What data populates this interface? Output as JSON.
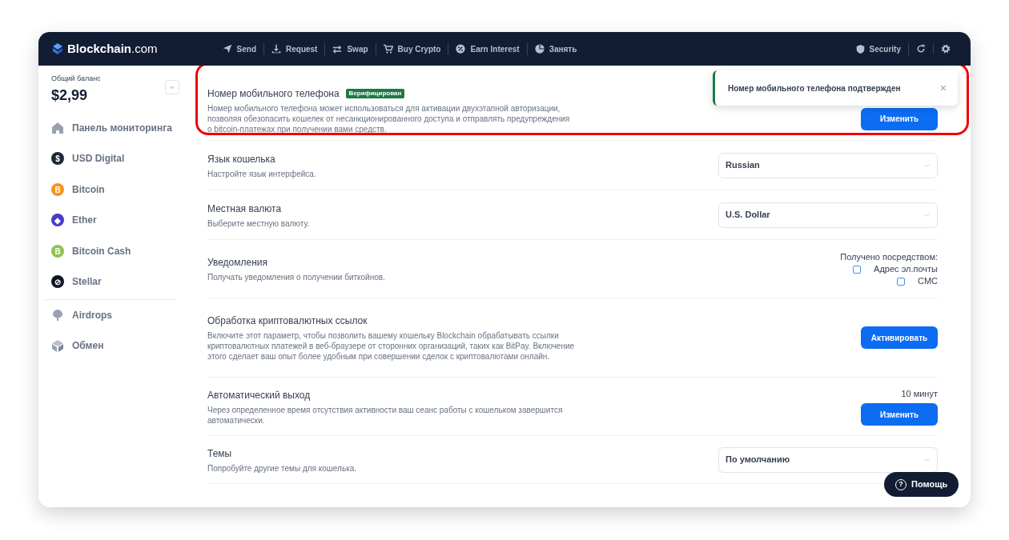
{
  "navbar": {
    "logo": {
      "name": "Blockchain",
      "suffix": ".com"
    },
    "items": [
      {
        "label": "Send",
        "kind": "send"
      },
      {
        "label": "Request",
        "kind": "download"
      },
      {
        "label": "Swap",
        "kind": "swap"
      },
      {
        "label": "Buy Crypto",
        "kind": "cart"
      },
      {
        "label": "Earn Interest",
        "kind": "percent"
      },
      {
        "label": "Занять",
        "kind": "pie"
      }
    ],
    "right": {
      "security": "Security"
    }
  },
  "sidebar": {
    "balance_label": "Общий баланс",
    "balance": "$2,99",
    "items": [
      {
        "label": "Панель мониторинга",
        "kind": "house"
      },
      {
        "label": "USD Digital",
        "kind": "coin",
        "color": "#1e2a3b",
        "glyph": "$"
      },
      {
        "label": "Bitcoin",
        "kind": "coin",
        "color": "#f7931a",
        "glyph": "B"
      },
      {
        "label": "Ether",
        "kind": "coin",
        "color": "#473bcb",
        "glyph": "◆"
      },
      {
        "label": "Bitcoin Cash",
        "kind": "coin",
        "color": "#8dc351",
        "glyph": "B"
      },
      {
        "label": "Stellar",
        "kind": "coin",
        "color": "#0f1621",
        "glyph": "⊘"
      },
      {
        "label": "Airdrops",
        "kind": "balloon",
        "divider_before": true
      },
      {
        "label": "Обмен",
        "kind": "cube"
      }
    ]
  },
  "settings": [
    {
      "title": "Номер мобильного телефона",
      "badge": "Верифицирован",
      "highlighted": true,
      "description": "Номер мобильного телефона может использоваться для активации двухэтапной авторизации, позволяя обезопасить кошелек от несанкционированного доступа и отправлять предупреждения о bitcoin-платежах при получении вами средств.",
      "kind": "button",
      "button": "Изменить"
    },
    {
      "title": "Язык кошелька",
      "description": "Настройте язык интерфейса.",
      "kind": "select",
      "value": "Russian"
    },
    {
      "title": "Местная валюта",
      "description": "Выберите местную валюту.",
      "kind": "select",
      "value": "U.S. Dollar"
    },
    {
      "title": "Уведомления",
      "description": "Получать уведомления о получении биткойнов.",
      "kind": "checks",
      "caption": "Получено посредством:",
      "options": [
        {
          "label": "Адрес эл.почты",
          "checked": false
        },
        {
          "label": "СМС",
          "checked": false
        }
      ]
    },
    {
      "title": "Обработка криптовалютных ссылок",
      "description": "Включите этот параметр, чтобы позволить вашему кошельку Blockchain обрабатывать ссылки криптовалютных платежей в веб-браузере от сторонних организаций, таких как BitPay. Включение этого сделает ваш опыт более удобным при совершении сделок с криптовалютами онлайн.",
      "kind": "button",
      "button": "Активировать"
    },
    {
      "title": "Автоматический выход",
      "description": "Через определенное время отсутствия активности ваш сеанс работы с кошельком завершится автоматически.",
      "kind": "button",
      "caption": "10 минут",
      "button": "Изменить"
    },
    {
      "title": "Темы",
      "description": "Попробуйте другие темы для кошелька.",
      "kind": "select",
      "value": "По умолчанию"
    }
  ],
  "toast": {
    "message": "Номер мобильного телефона подтвержден",
    "close": "×"
  },
  "help_button": {
    "label": "Помощь",
    "icon": "?"
  }
}
